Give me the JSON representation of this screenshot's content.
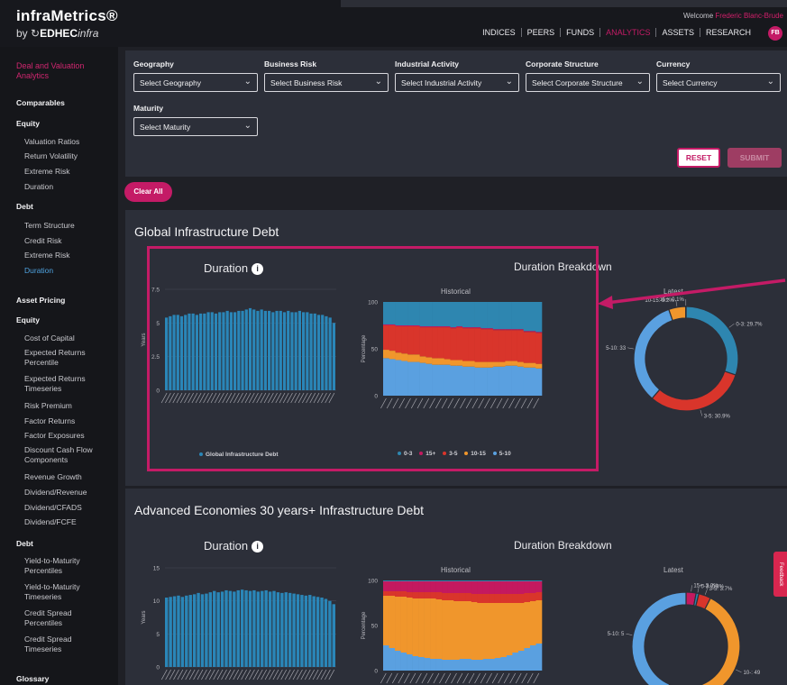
{
  "header": {
    "brand_name": "infraMetrics®",
    "brand_by": "by",
    "brand_company": "EDHEC",
    "brand_company_suffix": "infra",
    "welcome_prefix": "Welcome",
    "welcome_user": "Frederic Blanc-Brude",
    "avatar_initials": "FB",
    "nav": [
      {
        "label": "INDICES",
        "active": false
      },
      {
        "label": "PEERS",
        "active": false
      },
      {
        "label": "FUNDS",
        "active": false
      },
      {
        "label": "ANALYTICS",
        "active": true
      },
      {
        "label": "ASSETS",
        "active": false
      },
      {
        "label": "RESEARCH",
        "active": false
      }
    ]
  },
  "sidebar": {
    "section_title": "Deal and Valuation Analytics",
    "comparables": "Comparables",
    "equity_head": "Equity",
    "equity_items": [
      "Valuation Ratios",
      "Return Volatility",
      "Extreme Risk",
      "Duration"
    ],
    "debt_head": "Debt",
    "debt_items": [
      "Term Structure",
      "Credit Risk",
      "Extreme Risk",
      "Duration"
    ],
    "asset_pricing": "Asset Pricing",
    "ap_equity_head": "Equity",
    "ap_equity_items": [
      "Cost of Capital",
      "Expected Returns Percentile",
      "Expected Returns Timeseries",
      "Risk Premium",
      "Factor Returns",
      "Factor Exposures",
      "Discount Cash Flow Components",
      "Revenue Growth",
      "Dividend/Revenue",
      "Dividend/CFADS",
      "Dividend/FCFE"
    ],
    "ap_debt_head": "Debt",
    "ap_debt_items": [
      "Yield-to-Maturity Percentiles",
      "Yield-to-Maturity Timeseries",
      "Credit Spread Percentiles",
      "Credit Spread Timeseries"
    ],
    "glossary": "Glossary"
  },
  "filters": {
    "geography": {
      "label": "Geography",
      "value": "Select Geography"
    },
    "business_risk": {
      "label": "Business Risk",
      "value": "Select Business Risk"
    },
    "industrial_activity": {
      "label": "Industrial Activity",
      "value": "Select Industrial Activity"
    },
    "corporate_structure": {
      "label": "Corporate Structure",
      "value": "Select Corporate Structure"
    },
    "currency": {
      "label": "Currency",
      "value": "Select Currency"
    },
    "maturity": {
      "label": "Maturity",
      "value": "Select Maturity"
    },
    "reset_label": "RESET",
    "submit_label": "SUBMIT",
    "clear_all_label": "Clear All"
  },
  "feedback_label": "Feedback",
  "colors": {
    "accent": "#c41b66",
    "bar": "#2a86b8",
    "light_blue": "#5aa0e0",
    "orange": "#f0962c",
    "red": "#d9352b",
    "magenta": "#c4195f",
    "teal": "#2e86b0"
  },
  "panels": [
    {
      "title": "Global Infrastructure Debt",
      "duration_title": "Duration",
      "breakdown_title": "Duration Breakdown",
      "historical_label": "Historical",
      "latest_label": "Latest",
      "y_axis_label": "Years",
      "pct_axis_label": "Percentage",
      "duration_legend": "Global Infrastructure Debt",
      "donut_labels": [
        "0-3: 29.7%",
        "3-5: 30.9%",
        "5-10: 33",
        "10-15: 5.2%",
        "15+: 0.1%"
      ],
      "breakdown_legend": [
        "0-3",
        "15+",
        "3-5",
        "10-15",
        "5-10"
      ]
    },
    {
      "title": "Advanced Economies 30 years+ Infrastructure Debt",
      "duration_title": "Duration",
      "breakdown_title": "Duration Breakdown",
      "historical_label": "Historical",
      "latest_label": "Latest",
      "y_axis_label": "Years",
      "pct_axis_label": "Percentage",
      "donut_labels": [
        "15+: 3.0%",
        "0-3: 0.8%",
        "3-5: 3.7%",
        "10-: 49",
        "5-10: 5"
      ]
    }
  ],
  "chart_data": [
    {
      "type": "bar",
      "title": "Duration",
      "ylabel": "Years",
      "ylim": [
        0,
        7.5
      ],
      "yticks": [
        "0",
        "2.5",
        "5",
        "7.5"
      ],
      "series": [
        {
          "name": "Global Infrastructure Debt",
          "values": [
            5.4,
            5.5,
            5.6,
            5.6,
            5.5,
            5.6,
            5.7,
            5.7,
            5.6,
            5.7,
            5.7,
            5.8,
            5.8,
            5.7,
            5.8,
            5.8,
            5.9,
            5.8,
            5.8,
            5.9,
            5.9,
            6.0,
            6.1,
            6.0,
            5.9,
            6.0,
            5.9,
            5.9,
            5.8,
            5.9,
            5.9,
            5.8,
            5.9,
            5.8,
            5.8,
            5.9,
            5.8,
            5.8,
            5.7,
            5.7,
            5.6,
            5.6,
            5.5,
            5.4,
            5.0
          ]
        }
      ]
    },
    {
      "type": "bar",
      "title": "Historical",
      "ylabel": "Percentage",
      "ylim": [
        0,
        100
      ],
      "yticks": [
        "0",
        "50",
        "100"
      ],
      "stack_order": [
        "5-10",
        "10-15",
        "3-5",
        "15+",
        "0-3"
      ],
      "series": [
        {
          "name": "5-10",
          "values": [
            40,
            39,
            38,
            37,
            36,
            36,
            35,
            34,
            33,
            33,
            33,
            32,
            32,
            31,
            31,
            30,
            30,
            30,
            31,
            31,
            32,
            32,
            31,
            30,
            30,
            29
          ]
        },
        {
          "name": "10-15",
          "values": [
            9,
            9,
            8,
            8,
            8,
            8,
            7,
            7,
            7,
            7,
            6,
            6,
            6,
            6,
            6,
            6,
            6,
            6,
            5,
            5,
            5,
            5,
            5,
            5,
            5,
            5
          ]
        },
        {
          "name": "3-5",
          "values": [
            26,
            27,
            28,
            29,
            30,
            30,
            31,
            32,
            33,
            33,
            34,
            34,
            35,
            35,
            35,
            36,
            35,
            35,
            34,
            34,
            33,
            33,
            34,
            33,
            33,
            33
          ]
        },
        {
          "name": "15+",
          "values": [
            1,
            1,
            1,
            1,
            1,
            1,
            1,
            1,
            1,
            1,
            1,
            1,
            1,
            1,
            1,
            1,
            1,
            1,
            1,
            1,
            1,
            1,
            1,
            1,
            1,
            1
          ]
        },
        {
          "name": "0-3",
          "values": [
            24,
            24,
            25,
            25,
            25,
            25,
            26,
            26,
            26,
            26,
            26,
            27,
            26,
            27,
            27,
            27,
            28,
            28,
            29,
            29,
            29,
            29,
            29,
            31,
            31,
            32
          ]
        }
      ]
    },
    {
      "type": "pie",
      "title": "Latest",
      "labels": [
        "0-3",
        "3-5",
        "5-10",
        "10-15",
        "15+"
      ],
      "values": [
        29.7,
        30.9,
        33.0,
        5.2,
        0.1
      ]
    },
    {
      "type": "bar",
      "title": "Duration",
      "ylabel": "Years",
      "ylim": [
        0,
        15
      ],
      "yticks": [
        "0",
        "5",
        "10",
        "15"
      ],
      "series": [
        {
          "name": "Advanced Economies 30 years+ Infrastructure Debt",
          "values": [
            10.5,
            10.6,
            10.7,
            10.8,
            10.6,
            10.8,
            10.9,
            11.0,
            11.2,
            11.0,
            11.1,
            11.3,
            11.5,
            11.3,
            11.4,
            11.6,
            11.5,
            11.4,
            11.6,
            11.7,
            11.6,
            11.5,
            11.6,
            11.4,
            11.5,
            11.6,
            11.4,
            11.5,
            11.3,
            11.2,
            11.3,
            11.2,
            11.1,
            11.0,
            10.9,
            10.8,
            10.9,
            10.7,
            10.6,
            10.5,
            10.3,
            10.0,
            9.5
          ]
        }
      ]
    },
    {
      "type": "bar",
      "title": "Historical",
      "ylabel": "Percentage",
      "ylim": [
        0,
        100
      ],
      "yticks": [
        "0",
        "50",
        "100"
      ],
      "stack_order": [
        "5-10",
        "10-15",
        "3-5",
        "15+",
        "0-3"
      ],
      "series": [
        {
          "name": "5-10",
          "values": [
            28,
            25,
            22,
            20,
            18,
            16,
            15,
            14,
            13,
            13,
            12,
            12,
            12,
            13,
            13,
            12,
            12,
            13,
            13,
            14,
            15,
            17,
            20,
            22,
            25,
            28,
            30
          ]
        },
        {
          "name": "10-15",
          "values": [
            55,
            58,
            60,
            62,
            63,
            64,
            65,
            66,
            67,
            66,
            66,
            66,
            65,
            64,
            64,
            64,
            63,
            62,
            62,
            61,
            60,
            58,
            55,
            53,
            51,
            49,
            48
          ]
        },
        {
          "name": "3-5",
          "values": [
            5,
            5,
            6,
            6,
            6,
            7,
            7,
            7,
            7,
            8,
            8,
            8,
            9,
            9,
            9,
            9,
            10,
            10,
            10,
            10,
            10,
            10,
            10,
            10,
            10,
            9,
            9
          ]
        },
        {
          "name": "15+",
          "values": [
            11,
            11,
            11,
            11,
            12,
            12,
            12,
            12,
            12,
            12,
            13,
            13,
            13,
            13,
            13,
            14,
            14,
            14,
            14,
            14,
            14,
            14,
            14,
            14,
            13,
            13,
            12
          ]
        },
        {
          "name": "0-3",
          "values": [
            1,
            1,
            1,
            1,
            1,
            1,
            1,
            1,
            1,
            1,
            1,
            1,
            1,
            1,
            1,
            1,
            1,
            1,
            1,
            1,
            1,
            1,
            1,
            1,
            1,
            1,
            1
          ]
        }
      ]
    },
    {
      "type": "pie",
      "title": "Latest",
      "labels": [
        "15+",
        "0-3",
        "3-5",
        "10-15",
        "5-10"
      ],
      "values": [
        3.0,
        0.8,
        3.7,
        49,
        43.5
      ]
    }
  ]
}
